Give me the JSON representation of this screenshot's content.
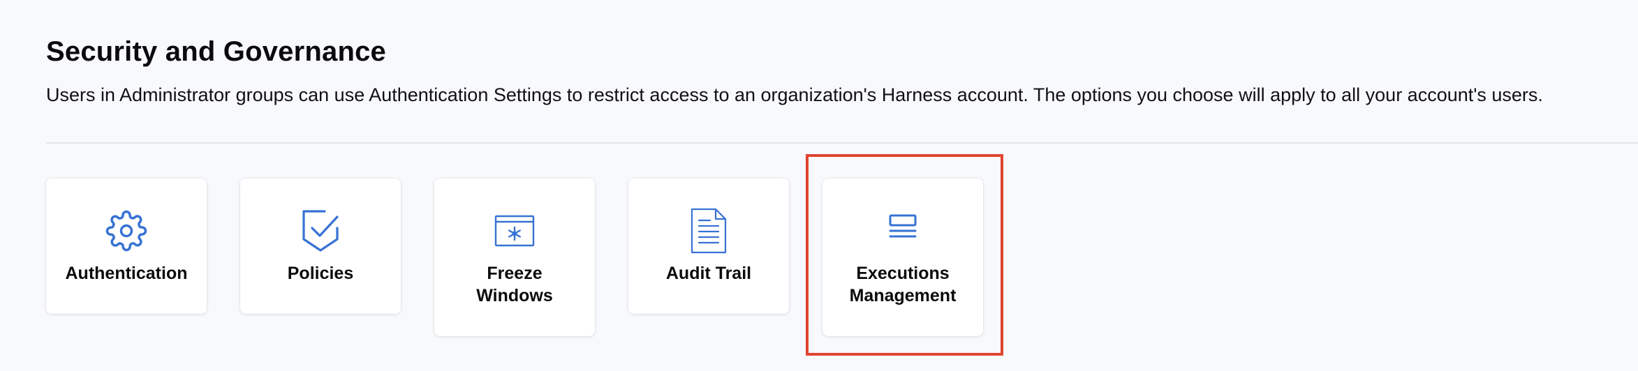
{
  "header": {
    "title": "Security and Governance",
    "description": "Users in Administrator groups can use Authentication Settings to restrict access to an organization's Harness account. The options you choose will apply to all your account's users."
  },
  "cards": [
    {
      "label": "Authentication",
      "icon": "gear-icon"
    },
    {
      "label": "Policies",
      "icon": "shield-check-icon"
    },
    {
      "label": "Freeze\nWindows",
      "icon": "freeze-window-icon"
    },
    {
      "label": "Audit Trail",
      "icon": "document-icon"
    },
    {
      "label": "Executions\nManagement",
      "icon": "executions-list-icon"
    }
  ],
  "colors": {
    "icon": "#3772d3",
    "highlight": "#e0452f",
    "background": "#f8f9fc"
  }
}
